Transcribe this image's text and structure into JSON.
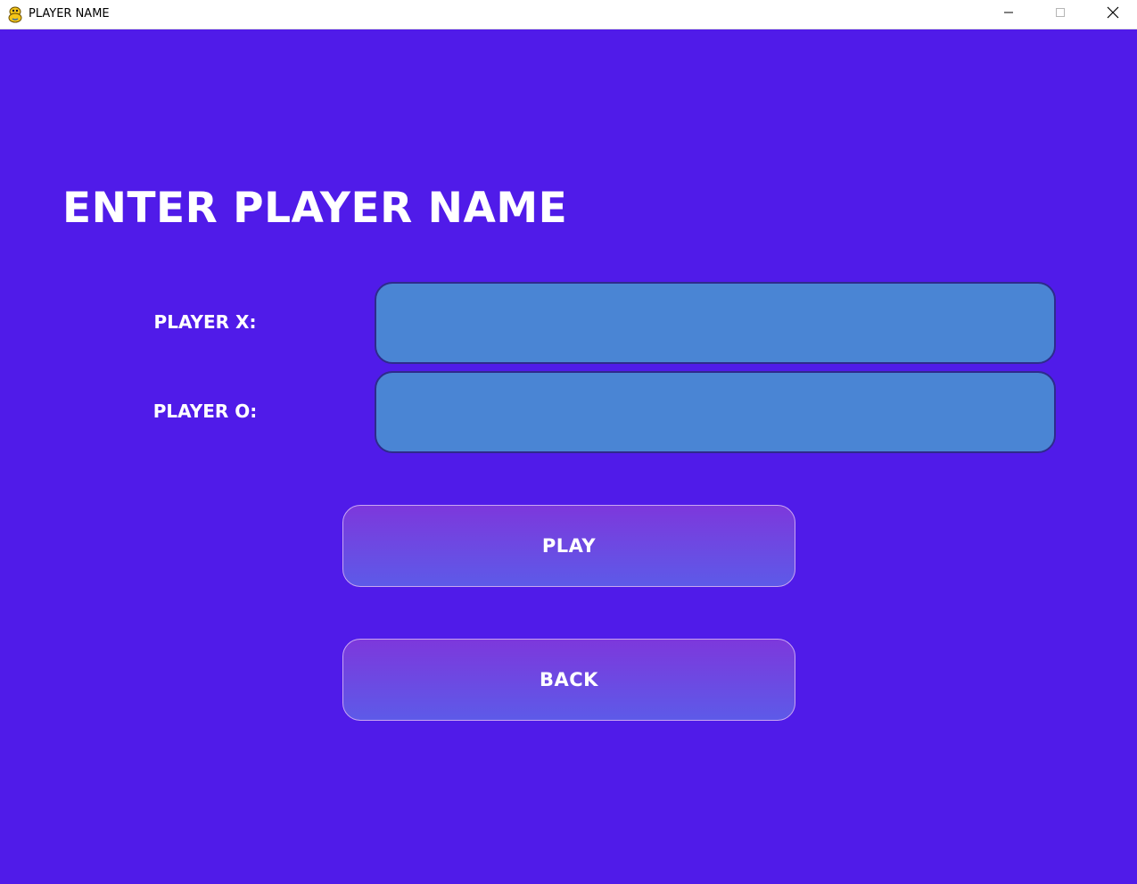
{
  "window": {
    "title": "PLAYER NAME",
    "app_icon": "python-snake-icon",
    "controls": {
      "minimize_icon": "minimize-icon",
      "maximize_icon": "maximize-icon",
      "close_icon": "close-icon"
    }
  },
  "screen": {
    "heading": "ENTER PLAYER NAME",
    "fields": [
      {
        "label": "PLAYER X:",
        "value": "",
        "placeholder": ""
      },
      {
        "label": "PLAYER O:",
        "value": "",
        "placeholder": ""
      }
    ],
    "buttons": {
      "play_label": "PLAY",
      "back_label": "BACK"
    }
  },
  "colors": {
    "background": "#501be9",
    "input_fill": "#4a85d4",
    "input_border": "#2e2b8c",
    "button_gradient_top": "#7d38dc",
    "button_gradient_bottom": "#5d5ae8",
    "text": "#ffffff"
  }
}
